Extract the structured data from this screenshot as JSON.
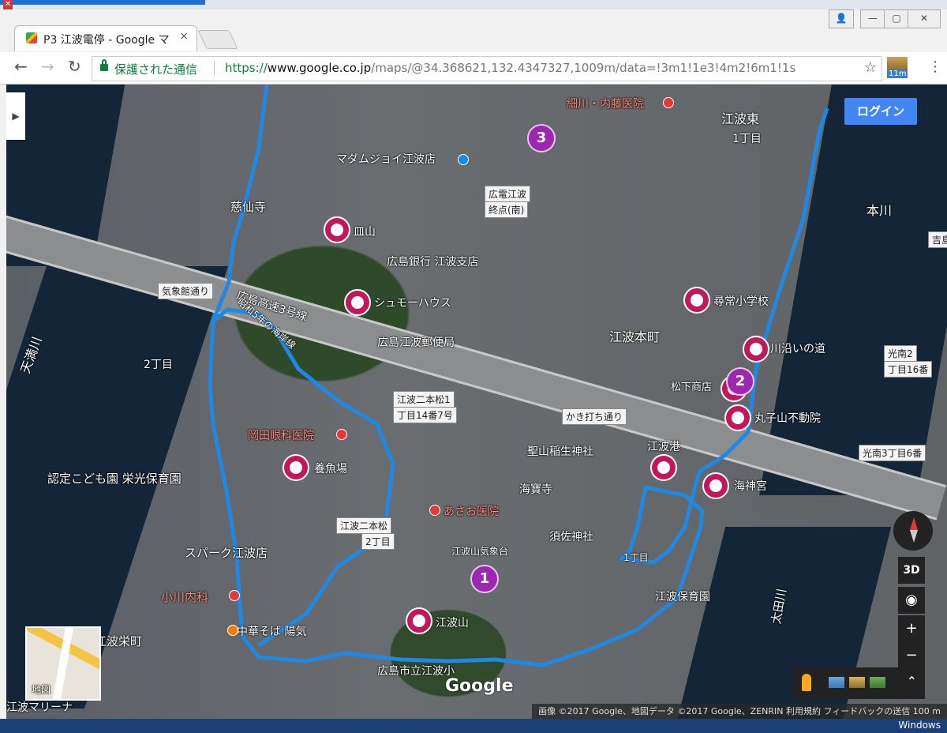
{
  "browser": {
    "tab_title": "P3 江波電停 - Google マ",
    "tab_close": "×",
    "secure_label": "保護された通信",
    "url_scheme": "https://",
    "url_domain": "www.google.co.jp",
    "url_path": "/maps/@34.368621,132.4347327,1009m/data=!3m1!1e3!4m2!6m1!1s",
    "extension_badge": "11m",
    "back": "←",
    "forward": "→",
    "reload": "↻",
    "star": "☆",
    "menu": "⋮",
    "window_user": "👤",
    "window_min": "—",
    "window_max": "▢",
    "window_close": "✕",
    "desktop_close": "✕"
  },
  "map": {
    "login_label": "ログイン",
    "sidebar_toggle": "▶",
    "minimap_label": "地図",
    "google_logo": "Google",
    "attribution": "画像 ©2017 Google、地図データ ©2017 Google、ZENRIN    利用規約    フィードバックの送信    100 m",
    "ctrl_3d": "3D",
    "ctrl_locate": "◉",
    "ctrl_zoom_in": "+",
    "ctrl_zoom_out": "−",
    "ctrl_expand": "⌃",
    "labels": [
      {
        "text": "細川・内藤医院",
        "style": "red"
      },
      {
        "text": "江波東",
        "style": ""
      },
      {
        "text": "1丁目",
        "style": ""
      },
      {
        "text": "マダムジョイ江波店",
        "style": ""
      },
      {
        "text": "広電江波",
        "style": "box"
      },
      {
        "text": "終点(南)",
        "style": "box"
      },
      {
        "text": "慈仙寺",
        "style": ""
      },
      {
        "text": "本川",
        "style": ""
      },
      {
        "text": "皿山",
        "style": ""
      },
      {
        "text": "広島銀行 江波支店",
        "style": ""
      },
      {
        "text": "気象館通り",
        "style": "box"
      },
      {
        "text": "広島高速3号線",
        "style": ""
      },
      {
        "text": "シュモーハウス",
        "style": ""
      },
      {
        "text": "尋常小学校",
        "style": ""
      },
      {
        "text": "広島江波郵便局",
        "style": ""
      },
      {
        "text": "江波本町",
        "style": ""
      },
      {
        "text": "川沿いの道",
        "style": ""
      },
      {
        "text": "天満川",
        "style": ""
      },
      {
        "text": "2丁目",
        "style": ""
      },
      {
        "text": "光南2",
        "style": "box"
      },
      {
        "text": "丁目16番",
        "style": "box"
      },
      {
        "text": "松下商店",
        "style": ""
      },
      {
        "text": "江波二本松1",
        "style": "box"
      },
      {
        "text": "丁目14番7号",
        "style": "box"
      },
      {
        "text": "かき打ち通り",
        "style": "box"
      },
      {
        "text": "丸子山不動院",
        "style": ""
      },
      {
        "text": "岡田眼科医院",
        "style": "red"
      },
      {
        "text": "聖山稲生神社",
        "style": ""
      },
      {
        "text": "江波港",
        "style": ""
      },
      {
        "text": "光南3丁目6番",
        "style": "box"
      },
      {
        "text": "養魚場",
        "style": ""
      },
      {
        "text": "認定こども園 栄光保育園",
        "style": ""
      },
      {
        "text": "海寶寺",
        "style": ""
      },
      {
        "text": "海神宮",
        "style": ""
      },
      {
        "text": "あさお医院",
        "style": "red"
      },
      {
        "text": "江波二本松",
        "style": "box"
      },
      {
        "text": "2丁目",
        "style": "box"
      },
      {
        "text": "須佐神社",
        "style": ""
      },
      {
        "text": "江波山気象台",
        "style": ""
      },
      {
        "text": "スパーク江波店",
        "style": ""
      },
      {
        "text": "1丁目",
        "style": ""
      },
      {
        "text": "小川内科",
        "style": "red"
      },
      {
        "text": "江波保育園",
        "style": ""
      },
      {
        "text": "太田川",
        "style": ""
      },
      {
        "text": "江波山",
        "style": ""
      },
      {
        "text": "中華そば 陽気",
        "style": ""
      },
      {
        "text": "江波栄町",
        "style": ""
      },
      {
        "text": "広島市立江波小",
        "style": ""
      },
      {
        "text": "江波マリーナ",
        "style": ""
      },
      {
        "text": "吉島",
        "style": "box"
      },
      {
        "text": "昭和5年の海岸線",
        "style": ""
      }
    ],
    "clusters": [
      "1",
      "2",
      "3"
    ]
  },
  "taskbar": {
    "text": "Windows"
  }
}
